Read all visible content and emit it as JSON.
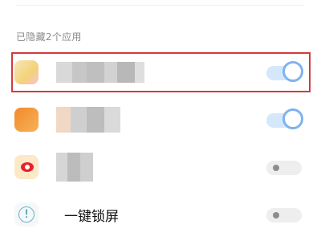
{
  "section": {
    "label": "已隐藏2个应用"
  },
  "apps": [
    {
      "name": "",
      "toggle": true
    },
    {
      "name": "",
      "toggle": true
    },
    {
      "name": "",
      "toggle": false
    },
    {
      "name": "一键锁屏",
      "toggle": false
    }
  ],
  "colors": {
    "highlight": "#d23b3b",
    "toggle_on_track": "#d5e7fb",
    "toggle_on_knob_border": "#7fb3ee",
    "toggle_off_track": "#eeeeee"
  },
  "icons": [
    "app-icon-blurred",
    "app-icon-orange",
    "weibo-icon",
    "lock-screen-icon"
  ]
}
